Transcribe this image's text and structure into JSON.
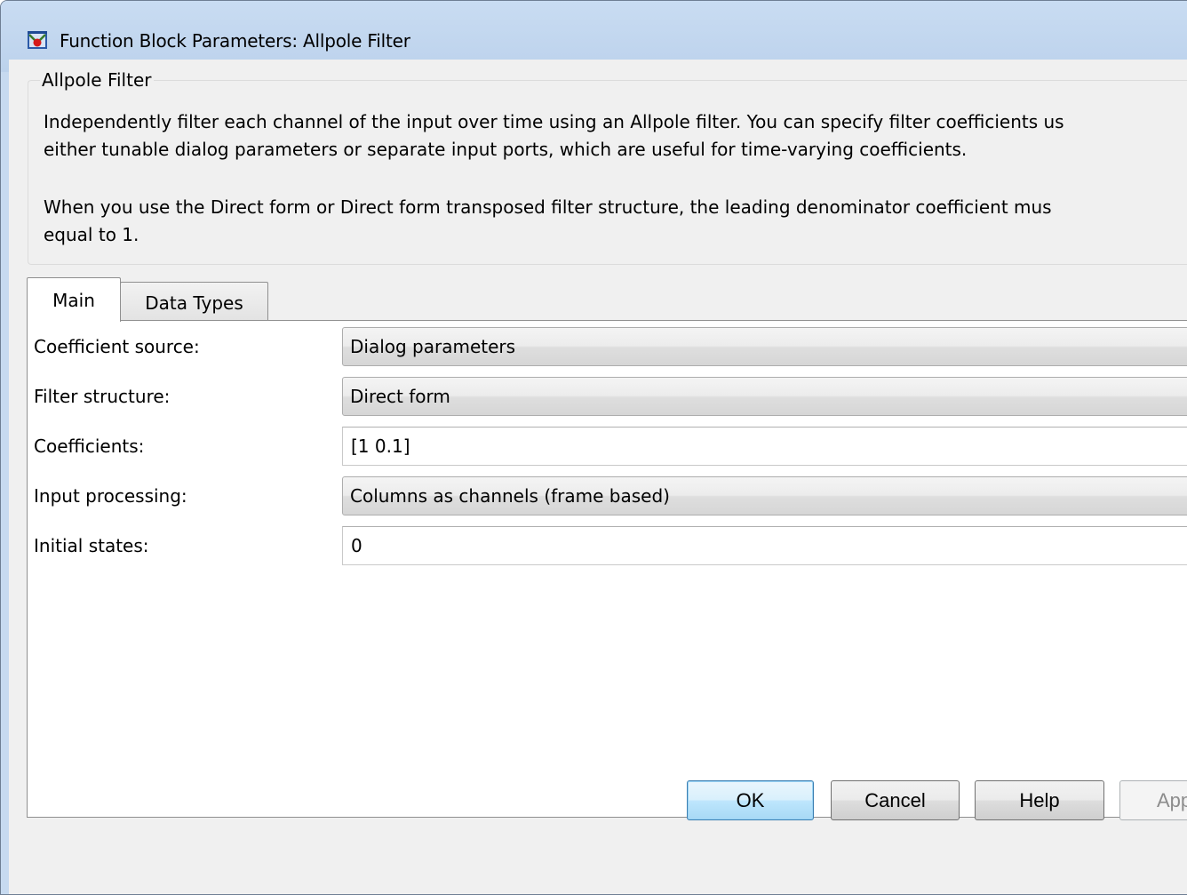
{
  "window": {
    "title": "Function Block Parameters: Allpole Filter",
    "icon": "simulink-block-icon"
  },
  "group": {
    "title": "Allpole Filter",
    "description_lines": [
      "Independently filter each channel of the input over time using an Allpole filter. You can specify filter coefficients us",
      "either tunable dialog parameters or separate input ports, which are useful for time-varying coefficients.",
      "When you use the Direct form or Direct form transposed filter structure, the leading denominator coefficient mus",
      "equal to 1."
    ]
  },
  "tabs": [
    {
      "label": "Main",
      "selected": true
    },
    {
      "label": "Data Types",
      "selected": false
    }
  ],
  "params": {
    "coefficient_source": {
      "label": "Coefficient source:",
      "value": "Dialog parameters"
    },
    "filter_structure": {
      "label": "Filter structure:",
      "value": "Direct form"
    },
    "coefficients": {
      "label": "Coefficients:",
      "value": "[1 0.1]"
    },
    "input_processing": {
      "label": "Input processing:",
      "value": "Columns as channels (frame based)"
    },
    "initial_states": {
      "label": "Initial states:",
      "value": "0"
    }
  },
  "buttons": {
    "ok": "OK",
    "cancel": "Cancel",
    "help": "Help",
    "apply": "App"
  }
}
